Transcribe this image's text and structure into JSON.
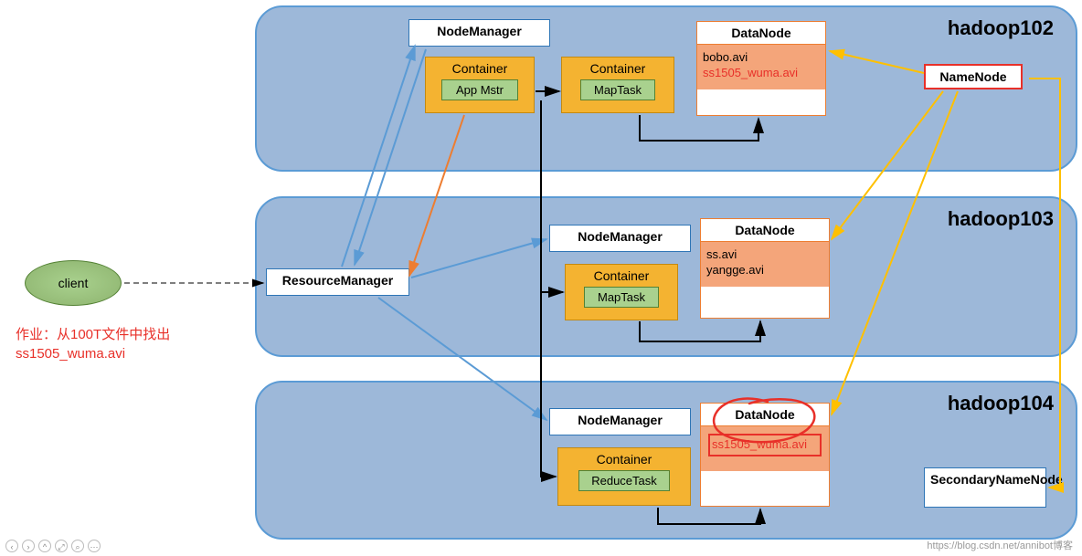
{
  "client_label": "client",
  "task_note_line1": "作业：从100T文件中找出",
  "task_note_line2": "ss1505_wuma.avi",
  "resource_manager": "ResourceManager",
  "node_manager": "NodeManager",
  "container_label": "Container",
  "app_mstr": "App Mstr",
  "map_task": "MapTask",
  "reduce_task": "ReduceTask",
  "datanode_label": "DataNode",
  "cluster1": {
    "name": "hadoop102",
    "files_plain": "bobo.avi",
    "files_highlight": "ss1505_wuma.avi"
  },
  "cluster2": {
    "name": "hadoop103",
    "files_line1": "ss.avi",
    "files_line2": "yangge.avi"
  },
  "cluster3": {
    "name": "hadoop104",
    "result_file": "ss1505_wuma.avi"
  },
  "namenode": "NameNode",
  "secondary_namenode": "SecondaryNameNode",
  "watermark": "https://blog.csdn.net/annibot博客",
  "colors": {
    "arrow_blue": "#5b9bd5",
    "arrow_orange": "#ed7d31",
    "arrow_gold": "#ffc000",
    "arrow_black": "#000"
  }
}
